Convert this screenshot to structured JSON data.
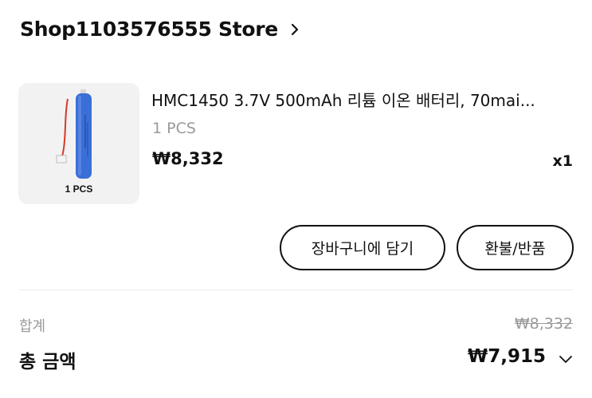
{
  "store": {
    "name": "Shop1103576555 Store",
    "chevron_icon": "chevron-right-icon"
  },
  "item": {
    "title": "HMC1450 3.7V 500mAh 리튬 이온 배터리, 70mai...",
    "variant": "1 PCS",
    "thumbnail_caption": "1 PCS",
    "price": "₩8,332",
    "quantity": "x1"
  },
  "actions": {
    "add_to_cart": "장바구니에 담기",
    "refund_return": "환불/반품"
  },
  "summary": {
    "subtotal_label": "합계",
    "subtotal_value": "₩8,332",
    "total_label": "총 금액",
    "total_value": "₩7,915",
    "expand_icon": "chevron-down-icon"
  },
  "colors": {
    "text_primary": "#111111",
    "text_muted": "#9a9a9a",
    "thumb_bg": "#f2f2f2",
    "battery_blue": "#3a6fd8"
  }
}
